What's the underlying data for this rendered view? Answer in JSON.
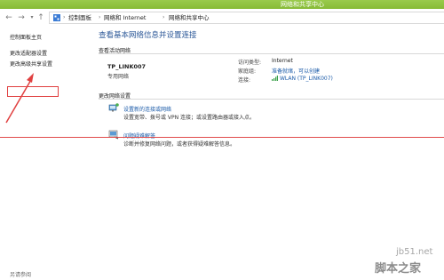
{
  "window": {
    "title": "网络和共享中心"
  },
  "address": {
    "crumbs": [
      "控制面板",
      "网络和 Internet",
      "网络和共享中心"
    ]
  },
  "left": {
    "home": "控制面板主页",
    "adapter": "更改适配器设置",
    "advanced": "更改高级共享设置",
    "see_also": "另请参阅"
  },
  "main": {
    "title": "查看基本网络信息并设置连接",
    "active_networks_label": "查看活动网络",
    "network": {
      "name": "TP_LINK007",
      "type": "专用网络",
      "access_label": "访问类型:",
      "access_value": "Internet",
      "homegroup_label": "家庭组:",
      "homegroup_value": "准备就绪，可以创建",
      "connection_label": "连接:",
      "connection_value": "WLAN (TP_LINK007)"
    },
    "change_settings_label": "更改网络设置",
    "tasks": [
      {
        "link": "设置新的连接或网络",
        "desc": "设置宽带、拨号或 VPN 连接；或设置路由器或接入点。"
      },
      {
        "link": "问题疑难解答",
        "desc": "诊断并修复网络问题，或者获得疑难解答信息。"
      }
    ]
  },
  "watermark": {
    "site": "jb51.net",
    "name": "脚本之家"
  },
  "colors": {
    "titlebar": "#8dc13f",
    "link": "#1a5aa8",
    "title": "#2b5797",
    "annotation": "#e04040"
  },
  "icons": [
    "back-arrow-icon",
    "forward-arrow-icon",
    "up-arrow-icon",
    "control-panel-icon",
    "wifi-signal-icon",
    "network-setup-icon",
    "troubleshoot-icon"
  ]
}
